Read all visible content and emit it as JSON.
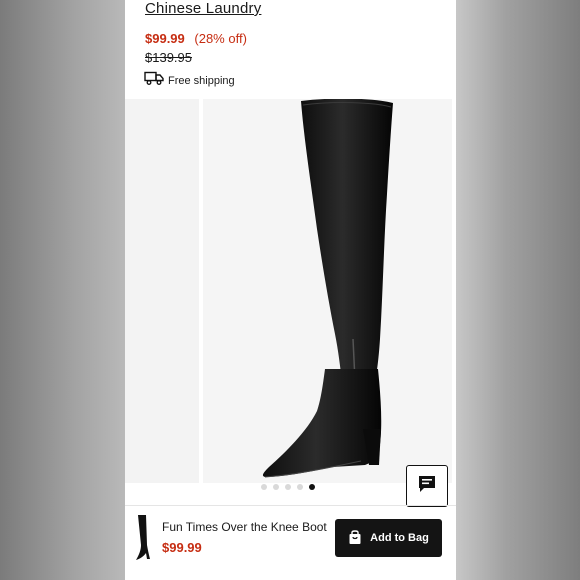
{
  "product": {
    "brand": "Chinese Laundry",
    "price": "$99.99",
    "discount": "(28% off)",
    "original_price": "$139.95",
    "shipping_label": "Free shipping"
  },
  "gallery": {
    "image_count": 5,
    "active_index": 4
  },
  "sticky_bar": {
    "product_name": "Fun Times Over the Knee Boot",
    "price": "$99.99",
    "add_label": "Add to Bag"
  },
  "icons": [
    "truck-icon",
    "chat-icon",
    "shopping-bag-icon"
  ],
  "colors": {
    "sale": "#c62d12",
    "button": "#141414"
  }
}
